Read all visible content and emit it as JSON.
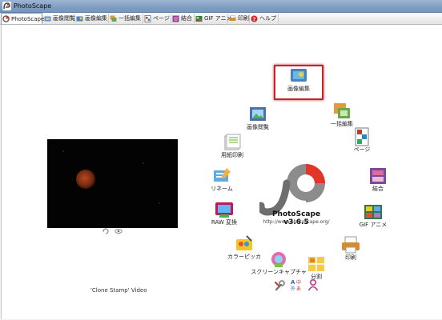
{
  "window": {
    "title": "PhotoScape"
  },
  "tabs": [
    {
      "label": "PhotoScape",
      "active": true
    },
    {
      "label": "画像閲覧"
    },
    {
      "label": "画像編集"
    },
    {
      "label": "一括編集"
    },
    {
      "label": "ページ"
    },
    {
      "label": "結合"
    },
    {
      "label": "GIF アニメ"
    },
    {
      "label": "印刷"
    },
    {
      "label": "ヘルプ"
    }
  ],
  "preview": {
    "caption": "'Clone Stamp' Video",
    "background": "#040304",
    "moon_color": "#8a3418"
  },
  "hub": {
    "app_name": "PhotoScape v3.6.5",
    "url": "http://www.photoscape.org/",
    "accent_color": "#e2362a",
    "items": [
      {
        "label": "画像編集",
        "icon": "photo-edit-icon",
        "selected": true
      },
      {
        "label": "一括編集",
        "icon": "batch-edit-icon"
      },
      {
        "label": "ページ",
        "icon": "page-icon"
      },
      {
        "label": "結合",
        "icon": "combine-icon"
      },
      {
        "label": "GIF アニメ",
        "icon": "gif-animation-icon"
      },
      {
        "label": "印刷",
        "icon": "print-icon"
      },
      {
        "label": "分割",
        "icon": "splitter-icon"
      },
      {
        "label": "スクリーンキャプチャ",
        "icon": "screen-capture-icon"
      },
      {
        "label": "カラーピッカ",
        "icon": "color-picker-icon"
      },
      {
        "label": "RAW 変換",
        "icon": "raw-converter-icon"
      },
      {
        "label": "リネーム",
        "icon": "rename-icon"
      },
      {
        "label": "用紙印刷",
        "icon": "paper-print-icon"
      },
      {
        "label": "画像閲覧",
        "icon": "viewer-icon"
      }
    ]
  },
  "tools": {
    "bottom": [
      {
        "icon": "settings-tools-icon"
      },
      {
        "icon": "language-icon",
        "text": "A中外あ"
      },
      {
        "icon": "user-icon"
      }
    ]
  },
  "selection_color": "#c0262f"
}
